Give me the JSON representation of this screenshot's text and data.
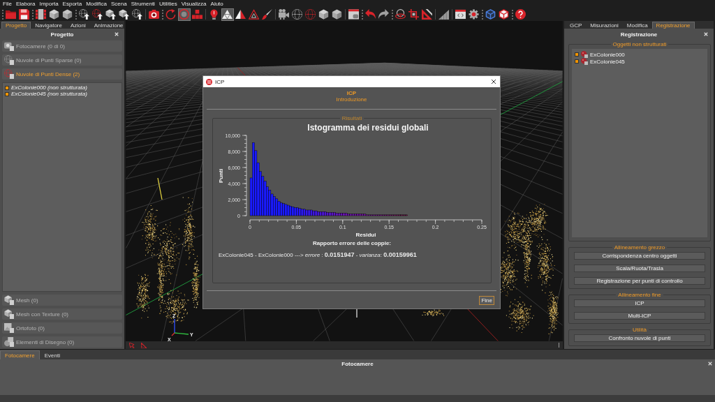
{
  "menu_bar": {
    "items": [
      "File",
      "Elabora",
      "Importa",
      "Esporta",
      "Modifica",
      "Scena",
      "Strumenti",
      "Utilities",
      "Visualizza",
      "Aiuto"
    ]
  },
  "toolbar": {
    "groups": [
      {
        "kind": "grip",
        "buttons": [
          {
            "on": false
          },
          {
            "on": false
          }
        ]
      },
      {
        "kind": "grip",
        "buttons": [
          {
            "on": false
          },
          {
            "on": false
          },
          {
            "on": false
          }
        ]
      },
      {
        "kind": "grip",
        "buttons": [
          {
            "on": false
          },
          {
            "on": false
          },
          {
            "on": false
          },
          {
            "on": false
          },
          {
            "on": false
          }
        ]
      },
      {
        "kind": "rule",
        "buttons": [
          {
            "on": false
          }
        ]
      },
      {
        "kind": "grip",
        "buttons": [
          {
            "on": false
          },
          {
            "on": true
          },
          {
            "on": false
          }
        ]
      },
      {
        "kind": "rule",
        "buttons": [
          {
            "on": false
          },
          {
            "on": true
          },
          {
            "on": false
          },
          {
            "on": false
          },
          {
            "on": false
          }
        ]
      },
      {
        "kind": "rule",
        "buttons": [
          {
            "on": false
          },
          {
            "on": false
          },
          {
            "on": false
          },
          {
            "on": false
          },
          {
            "on": false
          }
        ]
      },
      {
        "kind": "rule",
        "buttons": [
          {
            "on": false
          }
        ]
      },
      {
        "kind": "grip",
        "buttons": [
          {
            "on": false
          },
          {
            "on": false
          }
        ]
      },
      {
        "kind": "grip",
        "buttons": [
          {
            "on": false
          },
          {
            "on": false
          },
          {
            "on": false
          }
        ]
      },
      {
        "kind": "rule",
        "buttons": [
          {
            "on": false
          }
        ]
      },
      {
        "kind": "rule",
        "buttons": [
          {
            "on": false
          },
          {
            "on": false
          }
        ]
      },
      {
        "kind": "grip",
        "buttons": [
          {
            "on": false
          },
          {
            "on": false
          }
        ]
      },
      {
        "kind": "grip",
        "buttons": [
          {
            "on": false
          }
        ]
      }
    ]
  },
  "left_panel": {
    "tabs": [
      {
        "label": "Progetto",
        "selected": true
      },
      {
        "label": "Navigatore",
        "selected": false
      },
      {
        "label": "Azioni",
        "selected": false
      },
      {
        "label": "Animazione",
        "selected": false
      }
    ],
    "title": "Progetto",
    "sections": [
      {
        "label": "Fotocamere (0 di 0)",
        "expanded": false
      },
      {
        "label": "Nuvole di Punti Sparse (0)",
        "expanded": false
      },
      {
        "label": "Nuvole di Punti Dense (2)",
        "expanded": true,
        "items": [
          {
            "label": "ExColonie000 (non strutturata)",
            "checked": true
          },
          {
            "label": "ExColonie045 (non strutturata)",
            "checked": true
          }
        ]
      },
      {
        "label": "Mesh (0)",
        "expanded": false
      },
      {
        "label": "Mesh con Texture (0)",
        "expanded": false
      },
      {
        "label": "Ortofoto (0)",
        "expanded": false
      },
      {
        "label": "Elementi di Disegno (0)",
        "expanded": false
      }
    ]
  },
  "viewport": {
    "axis_labels": [
      "Z",
      "Y",
      "X"
    ]
  },
  "dialog": {
    "title": "ICP",
    "heading": "ICP",
    "subheading": "Introduzione",
    "group_title": "Risultati",
    "chart_data": {
      "type": "bar",
      "title": "Istogramma dei residui globali",
      "xlabel": "Residui",
      "ylabel": "Punti",
      "x": [
        0.00125,
        0.00375,
        0.00625,
        0.00875,
        0.01125,
        0.01375,
        0.01625,
        0.01875,
        0.02125,
        0.02375,
        0.02625,
        0.02875,
        0.03125,
        0.03375,
        0.03625,
        0.03875,
        0.04125,
        0.04375,
        0.04625,
        0.04875,
        0.05125,
        0.05375,
        0.05625,
        0.05875,
        0.06125,
        0.06375,
        0.06625,
        0.06875,
        0.07125,
        0.07375,
        0.07625,
        0.07875,
        0.08125,
        0.08375,
        0.08625,
        0.08875,
        0.09125,
        0.09375,
        0.09625,
        0.09875,
        0.10125,
        0.10375,
        0.10625,
        0.10875,
        0.11125,
        0.11375,
        0.11625,
        0.11875,
        0.12125,
        0.12375,
        0.12625,
        0.12875,
        0.13125,
        0.13375,
        0.13625,
        0.13875,
        0.14125,
        0.14375,
        0.14625,
        0.14875,
        0.15125,
        0.15375,
        0.15625,
        0.15875,
        0.16125,
        0.16375,
        0.16625,
        0.16875,
        0.17125,
        0.17375,
        0.17625,
        0.17875,
        0.18125,
        0.18375,
        0.18625,
        0.18875,
        0.19125,
        0.19375,
        0.19625,
        0.19875,
        0.20125,
        0.20375,
        0.20625,
        0.20875,
        0.21125,
        0.21375,
        0.21625,
        0.21875,
        0.22125,
        0.22375,
        0.22625,
        0.22875
      ],
      "values": [
        4700,
        9100,
        8100,
        6600,
        5500,
        4900,
        4300,
        3600,
        3200,
        2700,
        2400,
        2100,
        1800,
        1600,
        1500,
        1400,
        1300,
        1200,
        1100,
        1000,
        1000,
        900,
        800,
        800,
        700,
        700,
        700,
        600,
        600,
        500,
        500,
        500,
        500,
        400,
        400,
        400,
        400,
        300,
        300,
        300,
        300,
        300,
        200,
        200,
        200,
        200,
        200,
        200,
        200,
        200,
        100,
        100,
        100,
        100,
        100,
        100,
        100,
        100,
        100,
        100,
        100,
        100,
        100,
        100,
        100,
        100,
        100,
        100,
        0,
        0,
        0,
        0,
        0,
        0,
        0,
        0,
        0,
        0,
        0,
        0,
        0,
        0,
        0,
        0,
        0,
        0,
        0,
        0,
        0,
        0,
        0,
        0
      ],
      "xlim": [
        0,
        0.25
      ],
      "ylim": [
        0,
        10000
      ],
      "xticks": [
        0,
        0.05,
        0.1,
        0.15,
        0.2,
        0.25
      ],
      "yticks": [
        {
          "value": 0,
          "label": "0"
        },
        {
          "value": 2000,
          "label": "2,000"
        },
        {
          "value": 4000,
          "label": "4,000"
        },
        {
          "value": 6000,
          "label": "6,000"
        },
        {
          "value": 8000,
          "label": "8,000"
        },
        {
          "value": 10000,
          "label": "10,000"
        }
      ]
    },
    "report_title": "Rapporto errore delle coppie:",
    "report": "ExColonie045 - ExColonie000 ---> *errore* : **0.0151947** - *varianza*: **0.00159961**",
    "buttons": [
      {
        "label": "Fine",
        "focused": true
      }
    ]
  },
  "right_panel": {
    "tabs": [
      {
        "label": "GCP",
        "selected": false
      },
      {
        "label": "Misurazioni",
        "selected": false
      },
      {
        "label": "Modifica",
        "selected": false
      },
      {
        "label": "Registrazione",
        "selected": true
      }
    ],
    "title": "Registrazione",
    "groups": [
      {
        "kind": "list",
        "title": "Oggetti non strutturati",
        "items": [
          {
            "label": "ExColonie000",
            "checked": true
          },
          {
            "label": "ExColonie045",
            "checked": true
          }
        ]
      },
      {
        "kind": "buttons",
        "title": "Allineamento grezzo",
        "buttons": [
          "Corrispondenza centro oggetti",
          "Scala/Ruota/Trasla",
          "Registrazione per punti di controllo"
        ]
      },
      {
        "kind": "buttons",
        "title": "Allineamento fine",
        "buttons": [
          "ICP",
          "Multi-ICP"
        ]
      },
      {
        "kind": "buttons",
        "title": "Utilità",
        "buttons": [
          "Confronto nuvole di punti"
        ]
      }
    ]
  },
  "bottom_panel": {
    "tabs": [
      {
        "label": "Fotocamere",
        "selected": true
      },
      {
        "label": "Eventi",
        "selected": false
      }
    ],
    "title": "Fotocamere"
  }
}
